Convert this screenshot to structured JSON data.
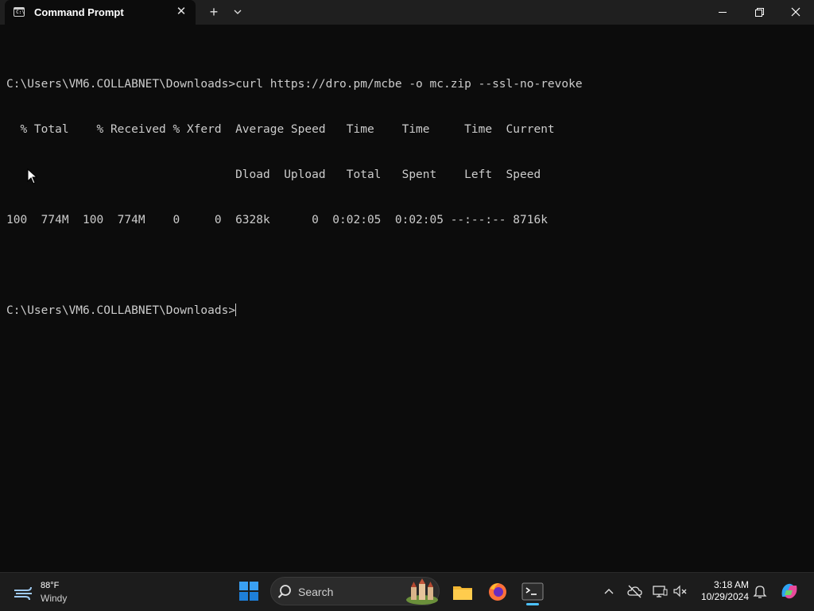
{
  "window": {
    "tab_title": "Command Prompt",
    "tab_icon_text": "C:\\",
    "new_tab_label": "+",
    "close_tab_label": "✕"
  },
  "console": {
    "lines": [
      "",
      "C:\\Users\\VM6.COLLABNET\\Downloads>curl https://dro.pm/mcbe -o mc.zip --ssl-no-revoke",
      "  % Total    % Received % Xferd  Average Speed   Time    Time     Time  Current",
      "                                 Dload  Upload   Total   Spent    Left  Speed",
      "100  774M  100  774M    0     0  6328k      0  0:02:05  0:02:05 --:--:-- 8716k",
      "",
      "C:\\Users\\VM6.COLLABNET\\Downloads>"
    ]
  },
  "taskbar": {
    "weather_temp": "88°F",
    "weather_desc": "Windy",
    "search_placeholder": "Search",
    "time": "3:18 AM",
    "date": "10/29/2024"
  },
  "colors": {
    "console_bg": "#0c0c0c",
    "console_text": "#cccccc",
    "accent": "#4cc2ff"
  }
}
